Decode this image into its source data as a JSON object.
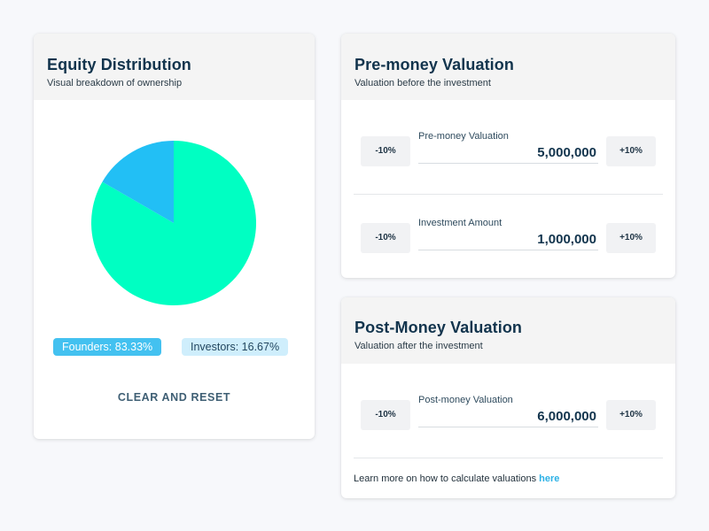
{
  "equity": {
    "title": "Equity Distribution",
    "subtitle": "Visual breakdown of ownership",
    "founders_label": "Founders: 83.33%",
    "investors_label": "Investors: 16.67%",
    "clear_label": "CLEAR AND RESET"
  },
  "chart_data": {
    "type": "pie",
    "labels": [
      "Founders",
      "Investors"
    ],
    "values": [
      83.33,
      16.67
    ],
    "colors": [
      "#00ffc2",
      "#22bff5"
    ]
  },
  "premoney": {
    "title": "Pre-money Valuation",
    "subtitle": "Valuation before the investment",
    "fields": [
      {
        "label": "Pre-money Valuation",
        "value": "5,000,000",
        "minus": "-10%",
        "plus": "+10%"
      },
      {
        "label": "Investment Amount",
        "value": "1,000,000",
        "minus": "-10%",
        "plus": "+10%"
      }
    ]
  },
  "postmoney": {
    "title": "Post-Money Valuation",
    "subtitle": "Valuation after the investment",
    "field": {
      "label": "Post-money Valuation",
      "value": "6,000,000",
      "minus": "-10%",
      "plus": "+10%"
    },
    "learn_text": "Learn more on how to calculate valuations",
    "learn_link": "here"
  }
}
